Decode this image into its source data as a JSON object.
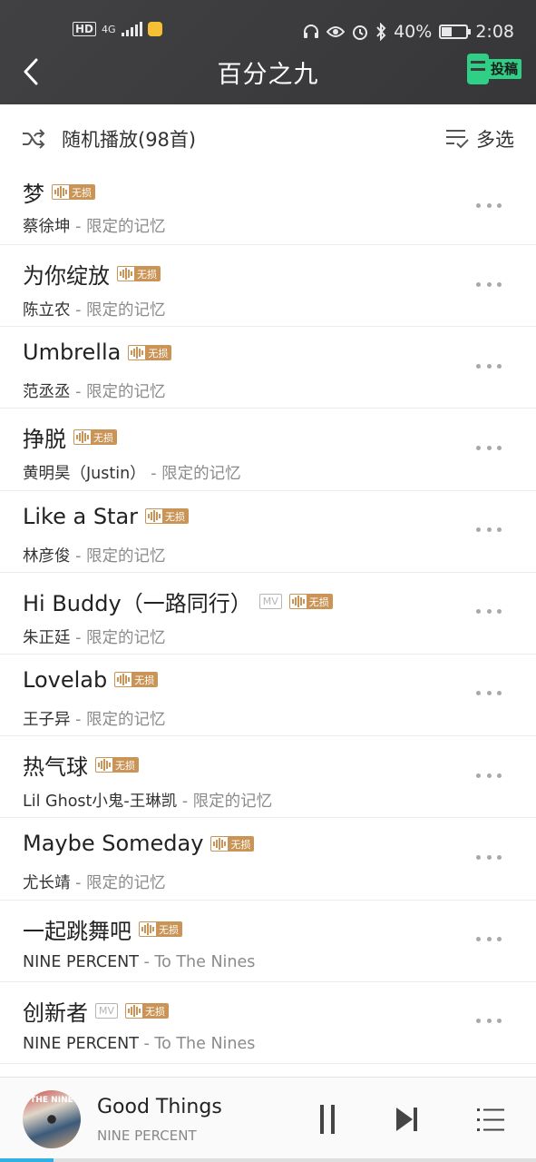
{
  "status_bar": {
    "hd": "HD",
    "network": "4G",
    "battery_text": "40%",
    "battery_level": 0.4,
    "time": "2:08",
    "icons": [
      "headphones-icon",
      "eye-icon",
      "alarm-icon",
      "bluetooth-icon"
    ]
  },
  "header": {
    "title": "百分之九",
    "contribute_label": "投稿",
    "back_icon": "back-arrow-icon"
  },
  "toolbar": {
    "shuffle_label": "随机播放(98首)",
    "multi_select_label": "多选"
  },
  "badges": {
    "lossless": "无损",
    "mv": "MV"
  },
  "songs": [
    {
      "title": "梦",
      "artist": "蔡徐坤",
      "album": "限定的记忆",
      "mv": false,
      "lossless": true
    },
    {
      "title": "为你绽放",
      "artist": "陈立农",
      "album": "限定的记忆",
      "mv": false,
      "lossless": true
    },
    {
      "title": "Umbrella",
      "artist": "范丞丞",
      "album": "限定的记忆",
      "mv": false,
      "lossless": true
    },
    {
      "title": "挣脱",
      "artist": "黄明昊（Justin）",
      "album": "限定的记忆",
      "mv": false,
      "lossless": true
    },
    {
      "title": "Like a Star",
      "artist": "林彦俊",
      "album": "限定的记忆",
      "mv": false,
      "lossless": true
    },
    {
      "title": "Hi Buddy（一路同行）",
      "artist": "朱正廷",
      "album": "限定的记忆",
      "mv": true,
      "lossless": true
    },
    {
      "title": "Lovelab",
      "artist": "王子异",
      "album": "限定的记忆",
      "mv": false,
      "lossless": true
    },
    {
      "title": "热气球",
      "artist": "Lil Ghost小鬼-王琳凯",
      "album": "限定的记忆",
      "mv": false,
      "lossless": true
    },
    {
      "title": "Maybe Someday",
      "artist": "尤长靖",
      "album": "限定的记忆",
      "mv": false,
      "lossless": true
    },
    {
      "title": "一起跳舞吧",
      "artist": "NINE PERCENT",
      "album": "To The Nines",
      "mv": false,
      "lossless": true
    },
    {
      "title": "创新者",
      "artist": "NINE PERCENT",
      "album": "To The Nines",
      "mv": true,
      "lossless": true
    }
  ],
  "player": {
    "cover_text": "THE NINE",
    "title": "Good Things",
    "artist": "NINE PERCENT",
    "progress": 0.1
  },
  "colors": {
    "header_bg": "#3b3b3e",
    "accent_green": "#2fcf86",
    "lossless_gold": "#c99456",
    "progress_blue": "#2fb1e4"
  }
}
